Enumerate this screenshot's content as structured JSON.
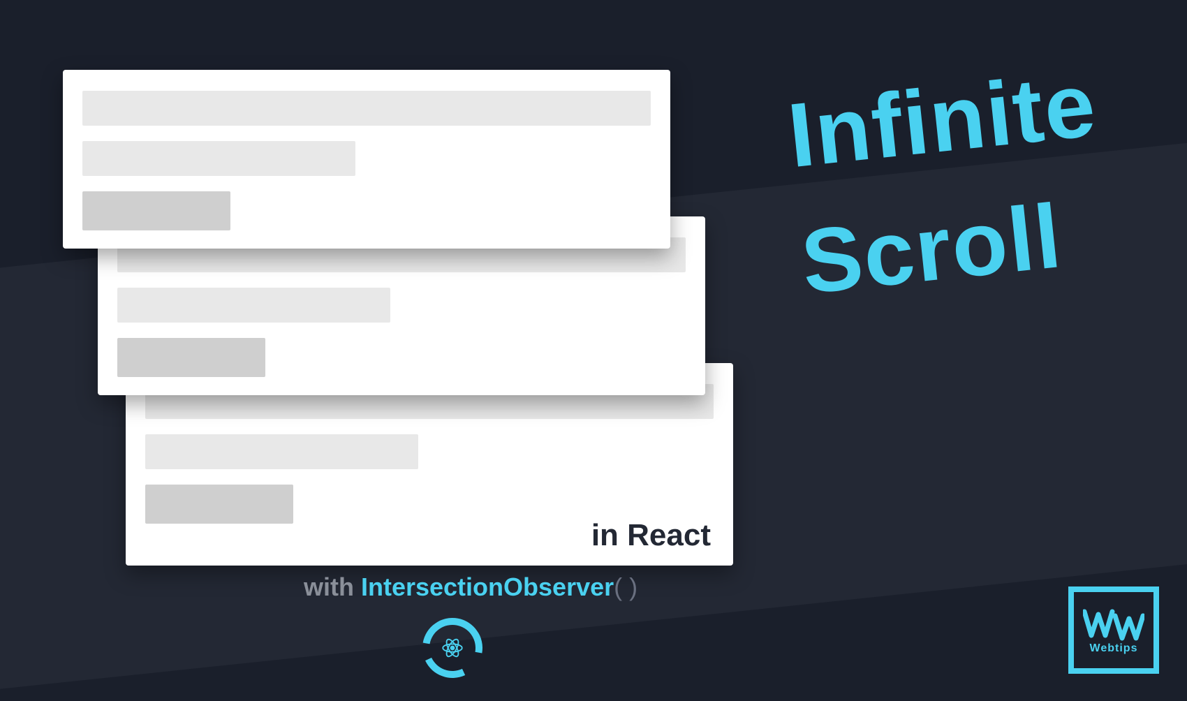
{
  "headline": {
    "line1": "Infinite",
    "line2": "Scroll"
  },
  "card3": {
    "label": "in React"
  },
  "sub": {
    "prefix": "with ",
    "api": "IntersectionObserver",
    "parens": "( )"
  },
  "logo": {
    "label": "Webtips"
  },
  "colors": {
    "accent": "#4ad1f0",
    "bg": "#1a1f2b",
    "slice": "#232834"
  }
}
